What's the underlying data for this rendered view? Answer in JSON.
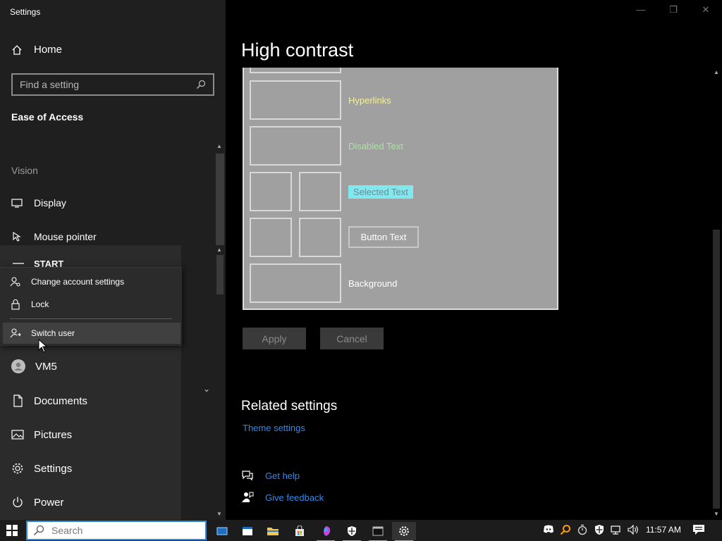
{
  "window": {
    "title": "Settings",
    "minimize": "—",
    "restore": "❐",
    "close": "✕"
  },
  "nav": {
    "home_label": "Home",
    "search_placeholder": "Find a setting",
    "category": "Ease of Access",
    "section_vision": "Vision",
    "items": [
      {
        "label": "Display",
        "icon": "display-icon"
      },
      {
        "label": "Mouse pointer",
        "icon": "mouse-pointer-icon"
      }
    ]
  },
  "start_menu": {
    "header": "START",
    "user": "VM5",
    "items": [
      {
        "label": "Documents",
        "icon": "document-icon"
      },
      {
        "label": "Pictures",
        "icon": "pictures-icon"
      },
      {
        "label": "Settings",
        "icon": "gear-icon"
      },
      {
        "label": "Power",
        "icon": "power-icon"
      }
    ],
    "popup": [
      {
        "label": "Change account settings",
        "icon": "user-settings-icon"
      },
      {
        "label": "Lock",
        "icon": "lock-icon"
      },
      {
        "label": "Switch user",
        "icon": "switch-user-icon"
      }
    ]
  },
  "main": {
    "title": "High contrast",
    "preview": {
      "hyperlinks": "Hyperlinks",
      "disabled_text": "Disabled Text",
      "selected_text": "Selected Text",
      "button_text": "Button Text",
      "background": "Background",
      "colors": {
        "hyperlinks": "#f6f28a",
        "disabled": "#a8e6a0",
        "selected_bg": "#7fe9ee",
        "preview_bg": "#a0a0a0"
      }
    },
    "apply": "Apply",
    "cancel": "Cancel",
    "related_title": "Related settings",
    "theme_link": "Theme settings",
    "get_help": "Get help",
    "give_feedback": "Give feedback"
  },
  "taskbar": {
    "search_placeholder": "Search",
    "time": "11:57 AM"
  }
}
